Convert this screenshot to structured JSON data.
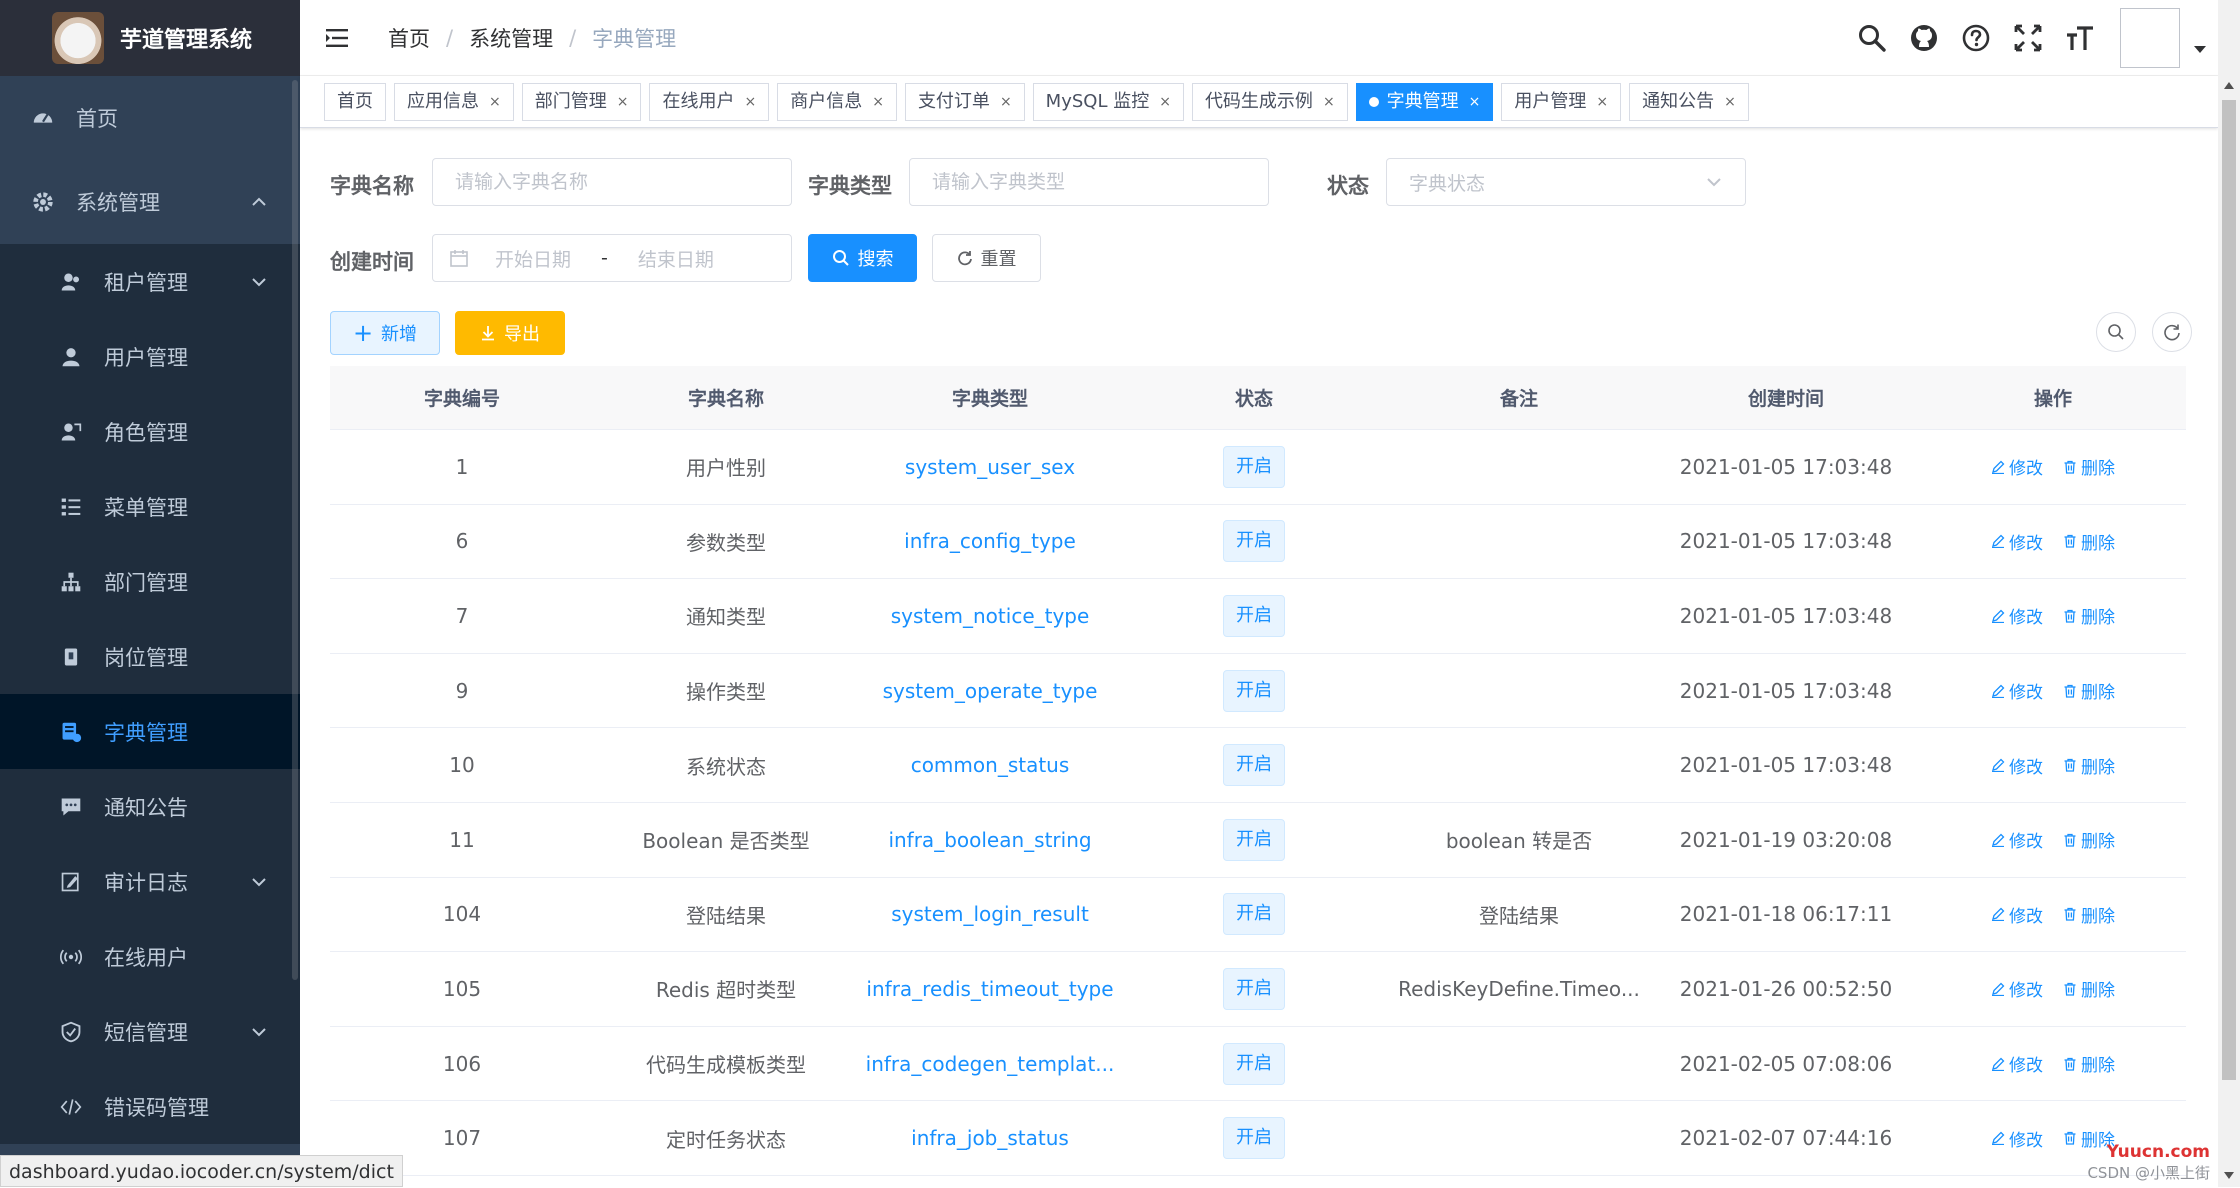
{
  "app": {
    "title": "芋道管理系统"
  },
  "sidebar": {
    "items": [
      {
        "label": "首页",
        "icon": "dashboard-icon",
        "level": "top",
        "name": "sidebar-item-home"
      },
      {
        "label": "系统管理",
        "icon": "gear-icon",
        "level": "top",
        "name": "sidebar-item-system",
        "expanded": true
      },
      {
        "label": "租户管理",
        "icon": "tenant-icon",
        "level": "sub",
        "name": "sidebar-item-tenant",
        "hasChildren": true
      },
      {
        "label": "用户管理",
        "icon": "user-icon",
        "level": "sub",
        "name": "sidebar-item-users"
      },
      {
        "label": "角色管理",
        "icon": "role-icon",
        "level": "sub",
        "name": "sidebar-item-roles"
      },
      {
        "label": "菜单管理",
        "icon": "list-icon",
        "level": "sub",
        "name": "sidebar-item-menus"
      },
      {
        "label": "部门管理",
        "icon": "tree-icon",
        "level": "sub",
        "name": "sidebar-item-depts"
      },
      {
        "label": "岗位管理",
        "icon": "post-icon",
        "level": "sub",
        "name": "sidebar-item-posts"
      },
      {
        "label": "字典管理",
        "icon": "dict-icon",
        "level": "sub",
        "name": "sidebar-item-dict",
        "active": true
      },
      {
        "label": "通知公告",
        "icon": "message-icon",
        "level": "sub",
        "name": "sidebar-item-notice"
      },
      {
        "label": "审计日志",
        "icon": "edit-log-icon",
        "level": "sub",
        "name": "sidebar-item-audit",
        "hasChildren": true
      },
      {
        "label": "在线用户",
        "icon": "online-icon",
        "level": "sub",
        "name": "sidebar-item-online"
      },
      {
        "label": "短信管理",
        "icon": "shield-icon",
        "level": "sub",
        "name": "sidebar-item-sms",
        "hasChildren": true
      },
      {
        "label": "错误码管理",
        "icon": "code-icon",
        "level": "sub",
        "name": "sidebar-item-errorcode"
      }
    ]
  },
  "navbar": {
    "breadcrumb": [
      "首页",
      "系统管理",
      "字典管理"
    ],
    "icons": [
      "search-icon",
      "github-icon",
      "question-icon",
      "fullscreen-icon",
      "font-size-icon"
    ]
  },
  "tags": [
    {
      "label": "首页",
      "closable": false
    },
    {
      "label": "应用信息",
      "closable": true
    },
    {
      "label": "部门管理",
      "closable": true
    },
    {
      "label": "在线用户",
      "closable": true
    },
    {
      "label": "商户信息",
      "closable": true
    },
    {
      "label": "支付订单",
      "closable": true
    },
    {
      "label": "MySQL 监控",
      "closable": true
    },
    {
      "label": "代码生成示例",
      "closable": true
    },
    {
      "label": "字典管理",
      "closable": true,
      "active": true
    },
    {
      "label": "用户管理",
      "closable": true
    },
    {
      "label": "通知公告",
      "closable": true
    }
  ],
  "tag_close": "×",
  "form": {
    "dict_name_label": "字典名称",
    "dict_name_placeholder": "请输入字典名称",
    "dict_type_label": "字典类型",
    "dict_type_placeholder": "请输入字典类型",
    "status_label": "状态",
    "status_placeholder": "字典状态",
    "create_time_label": "创建时间",
    "start_date_placeholder": "开始日期",
    "date_separator": "-",
    "end_date_placeholder": "结束日期",
    "search_button": "搜索",
    "reset_button": "重置"
  },
  "toolbar": {
    "add_button": "新增",
    "export_button": "导出"
  },
  "table": {
    "columns": [
      "字典编号",
      "字典名称",
      "字典类型",
      "状态",
      "备注",
      "创建时间",
      "操作"
    ],
    "edit_label": "修改",
    "delete_label": "删除",
    "rows": [
      {
        "id": "1",
        "name": "用户性别",
        "type": "system_user_sex",
        "status": "开启",
        "remark": "",
        "created": "2021-01-05 17:03:48"
      },
      {
        "id": "6",
        "name": "参数类型",
        "type": "infra_config_type",
        "status": "开启",
        "remark": "",
        "created": "2021-01-05 17:03:48"
      },
      {
        "id": "7",
        "name": "通知类型",
        "type": "system_notice_type",
        "status": "开启",
        "remark": "",
        "created": "2021-01-05 17:03:48"
      },
      {
        "id": "9",
        "name": "操作类型",
        "type": "system_operate_type",
        "status": "开启",
        "remark": "",
        "created": "2021-01-05 17:03:48"
      },
      {
        "id": "10",
        "name": "系统状态",
        "type": "common_status",
        "status": "开启",
        "remark": "",
        "created": "2021-01-05 17:03:48"
      },
      {
        "id": "11",
        "name": "Boolean 是否类型",
        "type": "infra_boolean_string",
        "status": "开启",
        "remark": "boolean 转是否",
        "created": "2021-01-19 03:20:08"
      },
      {
        "id": "104",
        "name": "登陆结果",
        "type": "system_login_result",
        "status": "开启",
        "remark": "登陆结果",
        "created": "2021-01-18 06:17:11"
      },
      {
        "id": "105",
        "name": "Redis 超时类型",
        "type": "infra_redis_timeout_type",
        "status": "开启",
        "remark": "RedisKeyDefine.Timeo...",
        "created": "2021-01-26 00:52:50"
      },
      {
        "id": "106",
        "name": "代码生成模板类型",
        "type": "infra_codegen_templat...",
        "status": "开启",
        "remark": "",
        "created": "2021-02-05 07:08:06"
      },
      {
        "id": "107",
        "name": "定时任务状态",
        "type": "infra_job_status",
        "status": "开启",
        "remark": "",
        "created": "2021-02-07 07:44:16"
      }
    ]
  },
  "status_bar": {
    "url": "dashboard.yudao.iocoder.cn/system/dict"
  },
  "watermark": {
    "brand": "Yuucn.com",
    "text": "CSDN @小黑上街"
  },
  "colors": {
    "sidebar_bg": "#304156",
    "sidebar_active": "#001528",
    "primary": "#1890ff",
    "warning": "#ffba00"
  }
}
